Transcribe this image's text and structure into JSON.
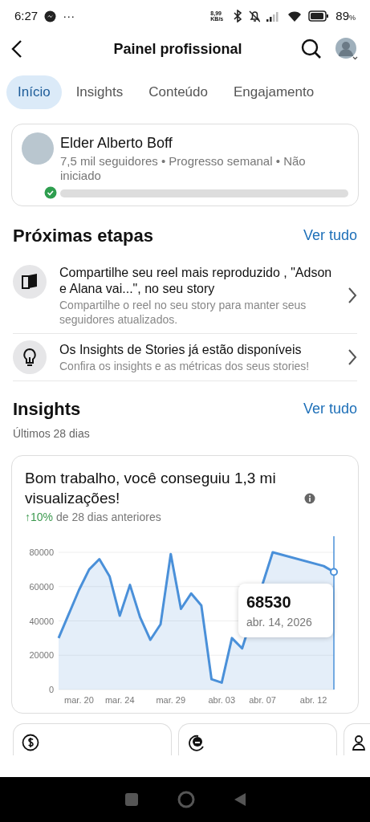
{
  "status_bar": {
    "time": "6:27",
    "more": "···",
    "speed": "8,99 KB/s",
    "battery": "89",
    "battery_unit": "%"
  },
  "header": {
    "title": "Painel profissional"
  },
  "tabs": [
    {
      "label": "Início",
      "selected": true
    },
    {
      "label": "Insights",
      "selected": false
    },
    {
      "label": "Conteúdo",
      "selected": false
    },
    {
      "label": "Engajamento",
      "selected": false
    }
  ],
  "profile": {
    "name": "Elder Alberto Boff",
    "meta": "7,5 mil seguidores • Progresso semanal • Não iniciado",
    "verified": true,
    "level": 0
  },
  "next_steps": {
    "title": "Próximas etapas",
    "link": "Ver tudo",
    "items": [
      {
        "kind": "book",
        "title": "Compartilhe seu reel mais reproduzido , \"Adson e Alana vai...\", no seu story",
        "subtitle": "Compartilhe o reel no seu story para manter seus seguidores atualizados."
      },
      {
        "kind": "bulb",
        "title": "Os Insights de Stories já estão disponíveis",
        "subtitle": "Confira os insights e as métricas dos seus stories!"
      }
    ]
  },
  "insights": {
    "title": "Insights",
    "link": "Ver tudo",
    "period": "Últimos 28 dias",
    "headline": "Bom trabalho, você conseguiu 1,3 mi visualizações!",
    "change": "↑10%",
    "change_text": "de 28 dias anteriores",
    "tooltip": {
      "value": "68530",
      "date": "abr. 14, 2026"
    },
    "chart_data": {
      "type": "area",
      "categories": [
        null,
        null,
        "mar. 20",
        null,
        null,
        null,
        "mar. 24",
        null,
        null,
        null,
        null,
        "mar. 29",
        null,
        null,
        null,
        null,
        "abr. 03",
        null,
        null,
        null,
        "abr. 07",
        null,
        null,
        null,
        null,
        "abr. 12",
        null,
        null
      ],
      "values": [
        30000,
        44000,
        58000,
        70000,
        76000,
        66000,
        43000,
        61000,
        42000,
        29000,
        38000,
        79000,
        47000,
        56000,
        49000,
        6000,
        4000,
        30000,
        24000,
        null,
        null,
        80000,
        null,
        null,
        null,
        null,
        72000,
        68530
      ],
      "ylim": [
        0,
        80000
      ],
      "yticks": [
        0,
        20000,
        40000,
        60000,
        80000
      ],
      "grid": true
    }
  },
  "metric_cards": [
    {
      "kind": "dollar"
    },
    {
      "kind": "like"
    },
    {
      "kind": "people"
    }
  ]
}
